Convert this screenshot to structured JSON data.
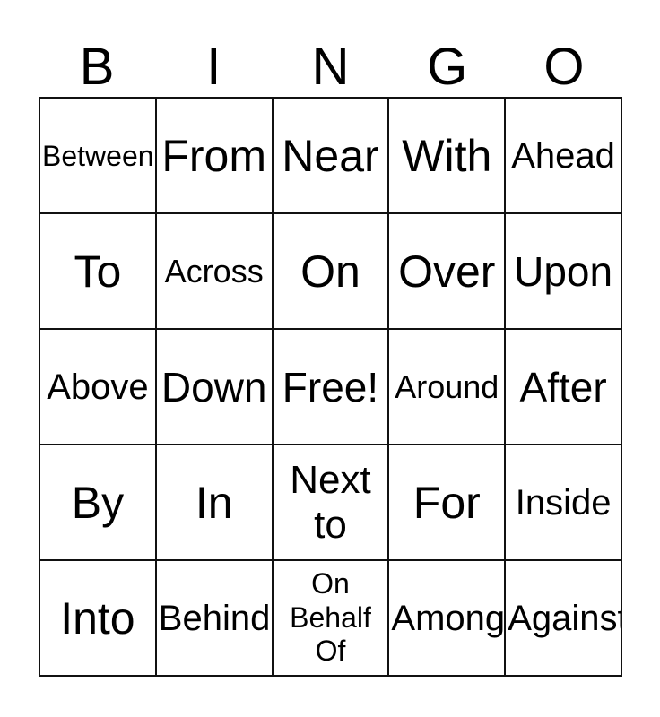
{
  "card": {
    "header_letters": [
      "B",
      "I",
      "N",
      "G",
      "O"
    ],
    "free_space_label": "Free!",
    "colors": {
      "background": "#ffffff",
      "text": "#000000",
      "grid_line": "#111111"
    },
    "grid": {
      "columns": 5,
      "rows": 5,
      "cells": [
        [
          {
            "label": "Between",
            "size": "xs"
          },
          {
            "label": "From",
            "size": "xl"
          },
          {
            "label": "Near",
            "size": "xl"
          },
          {
            "label": "With",
            "size": "xl"
          },
          {
            "label": "Ahead",
            "size": "md"
          }
        ],
        [
          {
            "label": "To",
            "size": "xl"
          },
          {
            "label": "Across",
            "size": "sm"
          },
          {
            "label": "On",
            "size": "xl"
          },
          {
            "label": "Over",
            "size": "xl"
          },
          {
            "label": "Upon",
            "size": "lg"
          }
        ],
        [
          {
            "label": "Above",
            "size": "md"
          },
          {
            "label": "Down",
            "size": "lg"
          },
          {
            "label": "Free!",
            "size": "lg"
          },
          {
            "label": "Around",
            "size": "sm"
          },
          {
            "label": "After",
            "size": "lg"
          }
        ],
        [
          {
            "label": "By",
            "size": "xl"
          },
          {
            "label": "In",
            "size": "xl"
          },
          {
            "label": "Next\nto",
            "size": "two"
          },
          {
            "label": "For",
            "size": "xl"
          },
          {
            "label": "Inside",
            "size": "md"
          }
        ],
        [
          {
            "label": "Into",
            "size": "xl"
          },
          {
            "label": "Behind",
            "size": "md"
          },
          {
            "label": "On\nBehalf\nOf",
            "size": "three"
          },
          {
            "label": "Among",
            "size": "md"
          },
          {
            "label": "Against",
            "size": "md"
          }
        ]
      ]
    }
  }
}
